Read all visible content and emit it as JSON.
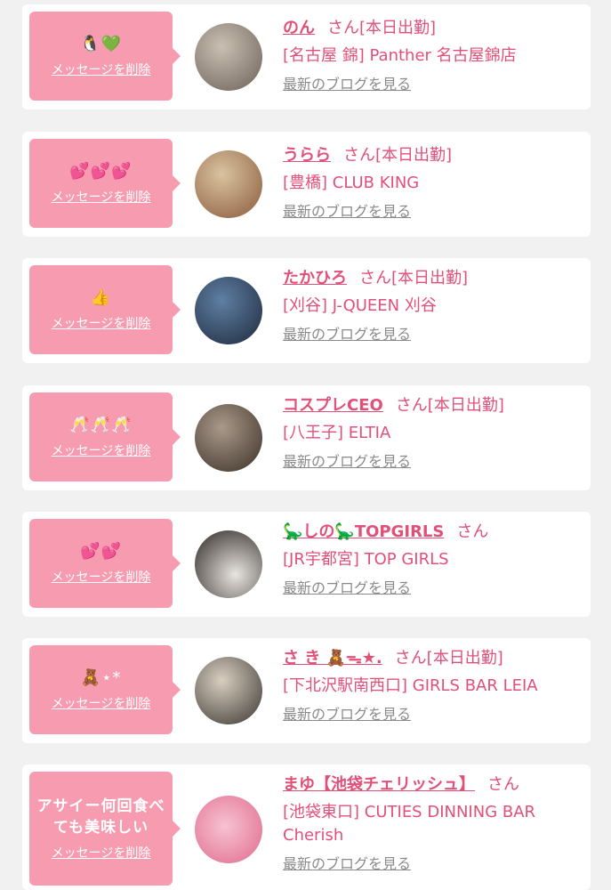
{
  "entries": [
    {
      "message": "🐧💚",
      "delete_label": "メッセージを削除",
      "name": "のん",
      "suffix": "さん[本日出勤]",
      "shop": "[名古屋 錦] Panther 名古屋錦店",
      "blog_label": "最新のブログを見る",
      "avatar_colors": [
        "#6b6157",
        "#c9bfb3"
      ]
    },
    {
      "message": "💕💕💕",
      "delete_label": "メッセージを削除",
      "name": "うらら",
      "suffix": "さん[本日出勤]",
      "shop": "[豊橋] CLUB KING",
      "blog_label": "最新のブログを見る",
      "avatar_colors": [
        "#8a5a3c",
        "#d9c3a0"
      ]
    },
    {
      "message": "👍",
      "delete_label": "メッセージを削除",
      "name": "たかひろ",
      "suffix": "さん[本日出勤]",
      "shop": "[刈谷] J-QUEEN 刈谷",
      "blog_label": "最新のブログを見る",
      "avatar_colors": [
        "#1e2a3c",
        "#5f7fa3"
      ]
    },
    {
      "message": "🥂🥂🥂",
      "delete_label": "メッセージを削除",
      "name": "コスプレCEO",
      "suffix": "さん[本日出勤]",
      "shop": "[八王子] ELTIA",
      "blog_label": "最新のブログを見る",
      "avatar_colors": [
        "#3b3026",
        "#a9998a"
      ]
    },
    {
      "message": "💕💕",
      "delete_label": "メッセージを削除",
      "name": "🦕しの🦕TOPGIRLS",
      "suffix": "さん",
      "shop": "[JR宇都宮] TOP GIRLS",
      "blog_label": "最新のブログを見る",
      "avatar_colors": [
        "#2a2420",
        "#e8e4e0"
      ]
    },
    {
      "message": "🧸⋆*",
      "delete_label": "メッセージを削除",
      "name": "さ き 🧸ᯓ★.",
      "suffix": "さん[本日出勤]",
      "shop": "[下北沢駅南西口] GIRLS BAR LEIA",
      "blog_label": "最新のブログを見る",
      "avatar_colors": [
        "#3a3530",
        "#d8cfc0"
      ]
    },
    {
      "message": "アサイー何回食べ\nても美味しい",
      "delete_label": "メッセージを削除",
      "name": "まゆ【池袋チェリッシュ】",
      "suffix": "さん",
      "shop": "[池袋東口] CUTIES DINNING BAR Cherish",
      "blog_label": "最新のブログを見る",
      "avatar_colors": [
        "#e06a8c",
        "#f7c2d2"
      ]
    }
  ],
  "colors": {
    "accent": "#e2507a",
    "bubble": "#f79cb0",
    "link_gray": "#8a8a8a"
  }
}
